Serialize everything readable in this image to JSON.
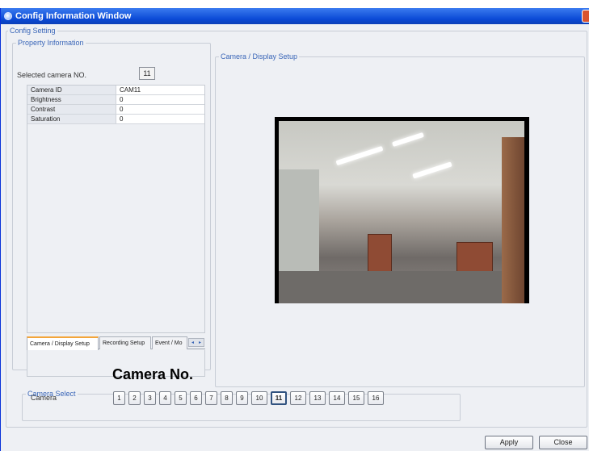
{
  "window": {
    "title": "Config Information Window"
  },
  "config_setting": {
    "legend": "Config Setting"
  },
  "property_info": {
    "legend": "Property Information",
    "selected_camera_label": "Selected camera NO.",
    "selected_camera_value": "11",
    "rows": [
      {
        "key": "Camera ID",
        "value": "CAM11"
      },
      {
        "key": "Brightness",
        "value": "0"
      },
      {
        "key": "Contrast",
        "value": "0"
      },
      {
        "key": "Saturation",
        "value": "0"
      }
    ],
    "tabs": [
      "Camera / Display Setup",
      "Recording Setup",
      "Event / Mo"
    ],
    "tab_scroll_left": "◂",
    "tab_scroll_right": "▸"
  },
  "display_setup": {
    "legend": "Camera / Display Setup"
  },
  "annotation": {
    "text": "Camera No."
  },
  "camera_select": {
    "legend": "Camera Select",
    "label": "Camera",
    "buttons": [
      "1",
      "2",
      "3",
      "4",
      "5",
      "6",
      "7",
      "8",
      "9",
      "10",
      "11",
      "12",
      "13",
      "14",
      "15",
      "16"
    ],
    "selected": "11"
  },
  "actions": {
    "apply": "Apply",
    "close": "Close"
  },
  "colors": {
    "title_bar": "#0a49d6",
    "legend_text": "#3a66b8",
    "active_tab_accent": "#f3a53a"
  }
}
